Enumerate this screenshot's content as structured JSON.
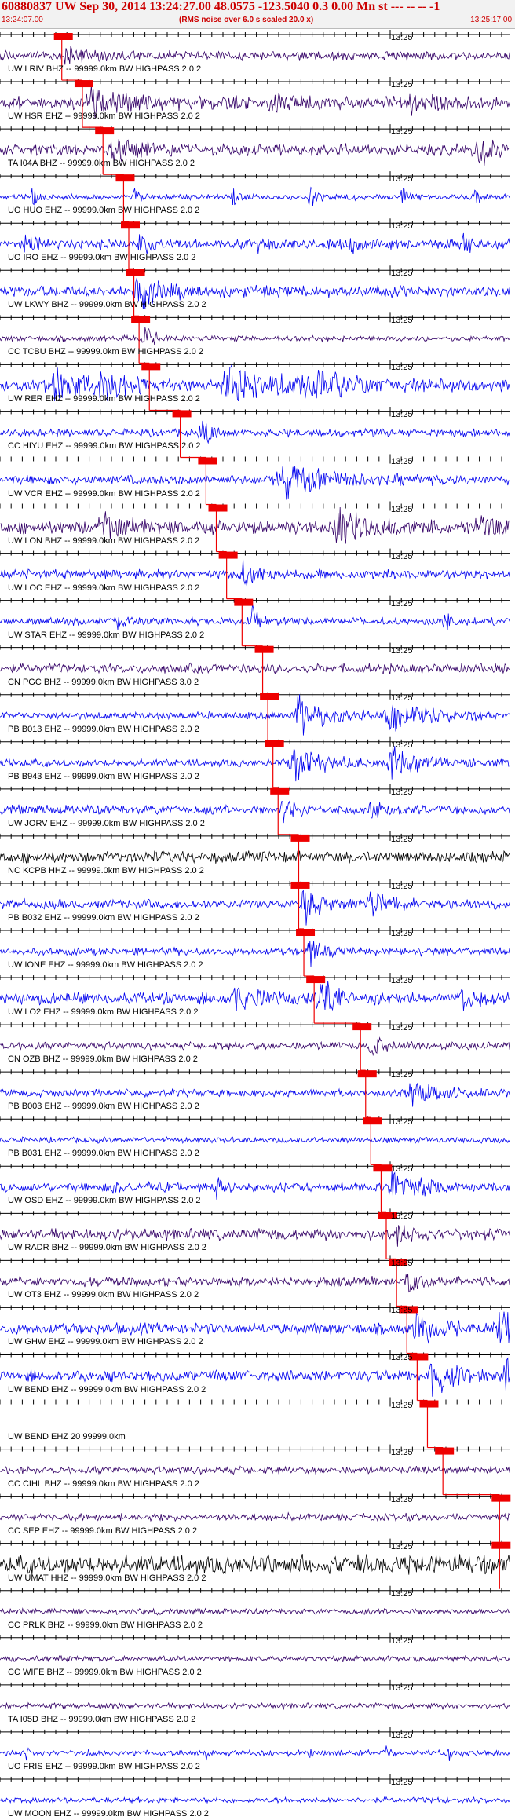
{
  "header": {
    "title": "60880837 UW Sep 30, 2014 13:24:27.00   48.0575 -123.5040  0.3 0.00 Mn st --- -- --  -1",
    "start_time": "13:24:07.00",
    "subtitle": "(RMS noise over 6.0 s scaled 20.0 x)",
    "end_time": "13:25:17.00"
  },
  "time_tick_label": "13:25",
  "colors": {
    "trace_blue": "#0000ee",
    "trace_purple": "#330066",
    "trace_black": "#000000",
    "pick_red": "#ee0000",
    "axis": "#000000"
  },
  "traces": [
    {
      "label": "UW LRIV BHZ -- 99999.0km BW  HIGHPASS  2.0  2",
      "color": "#330066",
      "amp": 0.25,
      "pick": 0.12,
      "events": [
        [
          0.13,
          0.4,
          0.05
        ]
      ]
    },
    {
      "label": "UW HSR EHZ -- 99999.0km BW  HIGHPASS  2.0  2",
      "color": "#330066",
      "amp": 0.35,
      "pick": 0.16,
      "events": [
        [
          0.18,
          0.8,
          0.06
        ],
        [
          0.52,
          0.5,
          0.04
        ],
        [
          0.8,
          0.6,
          0.03
        ]
      ]
    },
    {
      "label": "TA I04A BHZ -- 99999.0km BW  HIGHPASS  2.0  2",
      "color": "#330066",
      "amp": 0.3,
      "pick": 0.2,
      "events": [
        [
          0.22,
          0.7,
          0.04
        ],
        [
          0.93,
          0.9,
          0.03
        ]
      ]
    },
    {
      "label": "UO HUO EHZ -- 99999.0km BW  HIGHPASS  2.0  2",
      "color": "#0000ee",
      "amp": 0.15,
      "pick": 0.24,
      "events": [
        [
          0.06,
          0.6,
          0.01
        ],
        [
          0.26,
          0.7,
          0.01
        ],
        [
          0.45,
          0.6,
          0.01
        ],
        [
          0.6,
          0.7,
          0.01
        ],
        [
          0.78,
          0.7,
          0.01
        ],
        [
          0.92,
          0.6,
          0.01
        ]
      ]
    },
    {
      "label": "UO IRO EHZ -- 99999.0km BW  HIGHPASS  2.0  2",
      "color": "#0000ee",
      "amp": 0.25,
      "pick": 0.25,
      "events": [
        [
          0.05,
          0.5,
          0.02
        ],
        [
          0.27,
          0.6,
          0.02
        ],
        [
          0.5,
          0.4,
          0.02
        ],
        [
          0.68,
          0.5,
          0.02
        ],
        [
          0.9,
          0.6,
          0.02
        ]
      ]
    },
    {
      "label": "UW LKWY BHZ -- 99999.0km BW  HIGHPASS  2.0  2",
      "color": "#0000ee",
      "amp": 0.3,
      "pick": 0.26,
      "events": [
        [
          0.27,
          0.9,
          0.04
        ]
      ]
    },
    {
      "label": "CC TCBU BHZ -- 99999.0km BW  HIGHPASS  2.0  2",
      "color": "#330066",
      "amp": 0.15,
      "pick": 0.27,
      "events": [
        [
          0.28,
          0.6,
          0.02
        ]
      ]
    },
    {
      "label": "UW RER EHZ -- 99999.0km BW  HIGHPASS  2.0  2",
      "color": "#0000ee",
      "amp": 0.3,
      "pick": 0.29,
      "events": [
        [
          0.1,
          0.9,
          0.06
        ],
        [
          0.2,
          0.7,
          0.05
        ],
        [
          0.45,
          0.9,
          0.1
        ],
        [
          0.6,
          0.6,
          0.08
        ]
      ]
    },
    {
      "label": "CC HIYU EHZ -- 99999.0km BW  HIGHPASS  2.0  2",
      "color": "#0000ee",
      "amp": 0.2,
      "pick": 0.35,
      "events": [
        [
          0.39,
          0.9,
          0.02
        ]
      ]
    },
    {
      "label": "UW VCR EHZ -- 99999.0km BW  HIGHPASS  2.0  2",
      "color": "#0000ee",
      "amp": 0.25,
      "pick": 0.4,
      "events": [
        [
          0.55,
          0.9,
          0.08
        ]
      ]
    },
    {
      "label": "UW LON BHZ -- 99999.0km BW  HIGHPASS  2.0  2",
      "color": "#330066",
      "amp": 0.35,
      "pick": 0.42,
      "events": [
        [
          0.2,
          0.6,
          0.05
        ],
        [
          0.65,
          0.95,
          0.05
        ],
        [
          0.93,
          0.6,
          0.04
        ]
      ]
    },
    {
      "label": "UW LOC EHZ -- 99999.0km BW  HIGHPASS  2.0  2",
      "color": "#0000ee",
      "amp": 0.25,
      "pick": 0.44,
      "events": [
        [
          0.47,
          0.8,
          0.03
        ]
      ]
    },
    {
      "label": "UW STAR EHZ -- 99999.0km BW  HIGHPASS  2.0  2",
      "color": "#0000ee",
      "amp": 0.2,
      "pick": 0.47,
      "events": [
        [
          0.22,
          0.5,
          0.02
        ],
        [
          0.49,
          0.9,
          0.01
        ],
        [
          0.86,
          0.8,
          0.01
        ]
      ]
    },
    {
      "label": "CN PGC BHZ -- 99999.0km BW  HIGHPASS  3.0  2",
      "color": "#330066",
      "amp": 0.25,
      "pick": 0.51,
      "events": []
    },
    {
      "label": "PB B013 EHZ -- 99999.0km BW  HIGHPASS  2.0  2",
      "color": "#0000ee",
      "amp": 0.2,
      "pick": 0.52,
      "events": [
        [
          0.58,
          1.0,
          0.05
        ],
        [
          0.76,
          0.8,
          0.06
        ]
      ]
    },
    {
      "label": "PB B943 EHZ -- 99999.0km BW  HIGHPASS  2.0  2",
      "color": "#0000ee",
      "amp": 0.2,
      "pick": 0.53,
      "events": [
        [
          0.57,
          1.0,
          0.05
        ],
        [
          0.76,
          0.8,
          0.05
        ]
      ]
    },
    {
      "label": "UW JORV EHZ -- 99999.0km BW  HIGHPASS  2.0  2",
      "color": "#0000ee",
      "amp": 0.25,
      "pick": 0.54,
      "events": [
        [
          0.55,
          0.9,
          0.02
        ],
        [
          0.72,
          0.5,
          0.02
        ]
      ]
    },
    {
      "label": "NC KCPB HHZ -- 99999.0km BW  HIGHPASS  2.0  2",
      "color": "#000000",
      "amp": 0.3,
      "pick": 0.58,
      "events": []
    },
    {
      "label": "PB B032 EHZ -- 99999.0km BW  HIGHPASS  2.0  2",
      "color": "#0000ee",
      "amp": 0.25,
      "pick": 0.58,
      "events": [
        [
          0.59,
          0.9,
          0.03
        ],
        [
          0.72,
          0.5,
          0.05
        ]
      ]
    },
    {
      "label": "UW IONE EHZ -- 99999.0km BW  HIGHPASS  2.0  2",
      "color": "#0000ee",
      "amp": 0.2,
      "pick": 0.59,
      "events": [
        [
          0.6,
          0.7,
          0.02
        ]
      ]
    },
    {
      "label": "UW LO2 EHZ -- 99999.0km BW  HIGHPASS  2.0  2",
      "color": "#0000ee",
      "amp": 0.3,
      "pick": 0.61,
      "events": [
        [
          0.45,
          0.5,
          0.06
        ],
        [
          0.62,
          0.9,
          0.04
        ],
        [
          0.9,
          0.5,
          0.03
        ]
      ]
    },
    {
      "label": "CN OZB BHZ -- 99999.0km BW  HIGHPASS  2.0  2",
      "color": "#330066",
      "amp": 0.2,
      "pick": 0.7,
      "events": [
        [
          0.72,
          0.5,
          0.03
        ]
      ]
    },
    {
      "label": "PB B003 EHZ -- 99999.0km BW  HIGHPASS  2.0  2",
      "color": "#0000ee",
      "amp": 0.2,
      "pick": 0.71,
      "events": [
        [
          0.8,
          0.6,
          0.05
        ]
      ]
    },
    {
      "label": "PB B031 EHZ -- 99999.0km BW  HIGHPASS  2.0  2",
      "color": "#0000ee",
      "amp": 0.15,
      "pick": 0.72,
      "events": []
    },
    {
      "label": "UW OSD EHZ -- 99999.0km BW  HIGHPASS  2.0  2",
      "color": "#0000ee",
      "amp": 0.25,
      "pick": 0.74,
      "events": [
        [
          0.22,
          0.4,
          0.01
        ],
        [
          0.42,
          0.9,
          0.01
        ],
        [
          0.76,
          1.0,
          0.03
        ],
        [
          0.82,
          0.6,
          0.02
        ]
      ]
    },
    {
      "label": "UW RADR BHZ -- 99999.0km BW  HIGHPASS  2.0  2",
      "color": "#330066",
      "amp": 0.3,
      "pick": 0.75,
      "events": [
        [
          0.77,
          0.6,
          0.02
        ]
      ]
    },
    {
      "label": "UW OT3 EHZ -- 99999.0km BW  HIGHPASS  2.0  2",
      "color": "#330066",
      "amp": 0.25,
      "pick": 0.77,
      "events": [
        [
          0.79,
          0.6,
          0.02
        ]
      ]
    },
    {
      "label": "UW GHW EHZ -- 99999.0km BW  HIGHPASS  2.0  2",
      "color": "#0000ee",
      "amp": 0.3,
      "pick": 0.79,
      "events": [
        [
          0.81,
          0.9,
          0.04
        ],
        [
          0.97,
          1.0,
          0.04
        ]
      ]
    },
    {
      "label": "UW BEND EHZ -- 99999.0km BW  HIGHPASS  2.0  2",
      "color": "#0000ee",
      "amp": 0.3,
      "pick": 0.81,
      "events": [
        [
          0.84,
          1.0,
          0.04
        ],
        [
          0.98,
          0.8,
          0.02
        ]
      ]
    },
    {
      "label": "UW BEND EHZ 20 99999.0km",
      "color": "#0000ee",
      "amp": 0.0,
      "pick": 0.83,
      "events": []
    },
    {
      "label": "CC CIHL BHZ -- 99999.0km BW  HIGHPASS  2.0  2",
      "color": "#330066",
      "amp": 0.2,
      "pick": 0.86,
      "events": []
    },
    {
      "label": "CC SEP EHZ -- 99999.0km BW  HIGHPASS  2.0  2",
      "color": "#330066",
      "amp": 0.2,
      "pick": 0.97,
      "events": []
    },
    {
      "label": "UW UMAT HHZ -- 99999.0km BW  HIGHPASS  2.0  2",
      "color": "#000000",
      "amp": 0.5,
      "pick": 0.97,
      "events": [
        [
          0.99,
          0.9,
          0.02
        ]
      ]
    },
    {
      "label": "CC PRLK BHZ -- 99999.0km BW  HIGHPASS  2.0  2",
      "color": "#330066",
      "amp": 0.15,
      "pick": null,
      "events": []
    },
    {
      "label": "CC WIFE BHZ -- 99999.0km BW  HIGHPASS  2.0  2",
      "color": "#330066",
      "amp": 0.15,
      "pick": null,
      "events": []
    },
    {
      "label": "TA I05D BHZ -- 99999.0km BW  HIGHPASS  2.0  2",
      "color": "#330066",
      "amp": 0.15,
      "pick": null,
      "events": []
    },
    {
      "label": "UO FRIS EHZ -- 99999.0km BW  HIGHPASS  2.0  2",
      "color": "#0000ee",
      "amp": 0.15,
      "pick": null,
      "events": [
        [
          0.05,
          0.5,
          0.005
        ],
        [
          0.17,
          0.4,
          0.005
        ],
        [
          0.4,
          0.5,
          0.005
        ],
        [
          0.6,
          0.5,
          0.005
        ],
        [
          0.75,
          0.4,
          0.005
        ],
        [
          0.87,
          0.5,
          0.005
        ]
      ]
    },
    {
      "label": "UW MOON EHZ -- 99999.0km BW  HIGHPASS  2.0  2",
      "color": "#0000ee",
      "amp": 0.15,
      "pick": null,
      "events": []
    }
  ]
}
